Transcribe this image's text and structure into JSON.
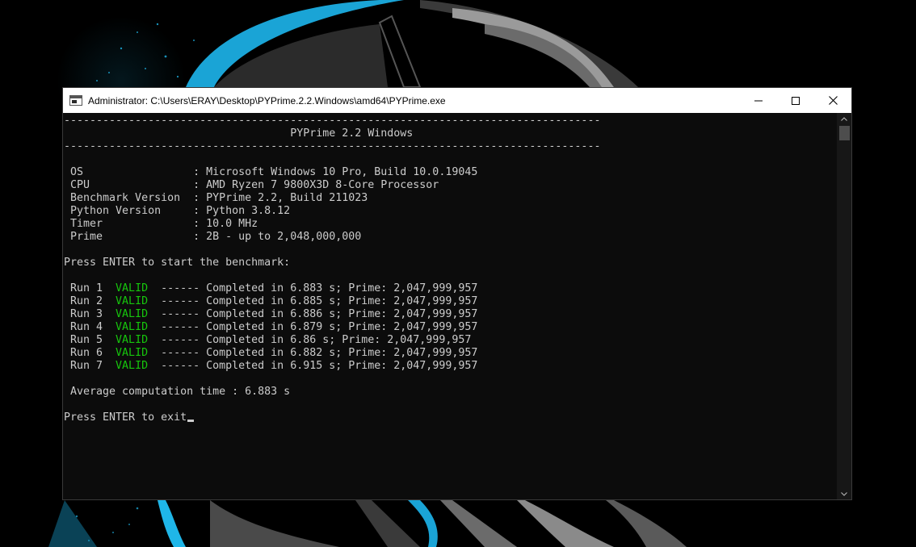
{
  "window": {
    "title": "Administrator: C:\\Users\\ERAY\\Desktop\\PYPrime.2.2.Windows\\amd64\\PYPrime.exe",
    "icon": "console-icon",
    "buttons": [
      "minimize-icon",
      "maximize-icon",
      "close-icon"
    ]
  },
  "console": {
    "separator": "-----------------------------------------------------------------------------------",
    "header": "                                   PYPrime 2.2 Windows",
    "info": [
      {
        "label": " OS                 ",
        "value": ": Microsoft Windows 10 Pro, Build 10.0.19045"
      },
      {
        "label": " CPU                ",
        "value": ": AMD Ryzen 7 9800X3D 8-Core Processor"
      },
      {
        "label": " Benchmark Version  ",
        "value": ": PYPrime 2.2, Build 211023"
      },
      {
        "label": " Python Version     ",
        "value": ": Python 3.8.12"
      },
      {
        "label": " Timer              ",
        "value": ": 10.0 MHz"
      },
      {
        "label": " Prime              ",
        "value": ": 2B - up to 2,048,000,000"
      }
    ],
    "start_prompt": "Press ENTER to start the benchmark:",
    "runs": [
      {
        "label": " Run 1  ",
        "status": "VALID",
        "text": "  ------ Completed in 6.883 s; Prime: 2,047,999,957"
      },
      {
        "label": " Run 2  ",
        "status": "VALID",
        "text": "  ------ Completed in 6.885 s; Prime: 2,047,999,957"
      },
      {
        "label": " Run 3  ",
        "status": "VALID",
        "text": "  ------ Completed in 6.886 s; Prime: 2,047,999,957"
      },
      {
        "label": " Run 4  ",
        "status": "VALID",
        "text": "  ------ Completed in 6.879 s; Prime: 2,047,999,957"
      },
      {
        "label": " Run 5  ",
        "status": "VALID",
        "text": "  ------ Completed in 6.86 s; Prime: 2,047,999,957"
      },
      {
        "label": " Run 6  ",
        "status": "VALID",
        "text": "  ------ Completed in 6.882 s; Prime: 2,047,999,957"
      },
      {
        "label": " Run 7  ",
        "status": "VALID",
        "text": "  ------ Completed in 6.915 s; Prime: 2,047,999,957"
      }
    ],
    "average": " Average computation time : 6.883 s",
    "exit_prompt": "Press ENTER to exit"
  },
  "colors": {
    "console_bg": "#0c0c0c",
    "console_text": "#cccccc",
    "valid": "#16c60c",
    "wallpaper_accent": "#1fb6e8"
  }
}
